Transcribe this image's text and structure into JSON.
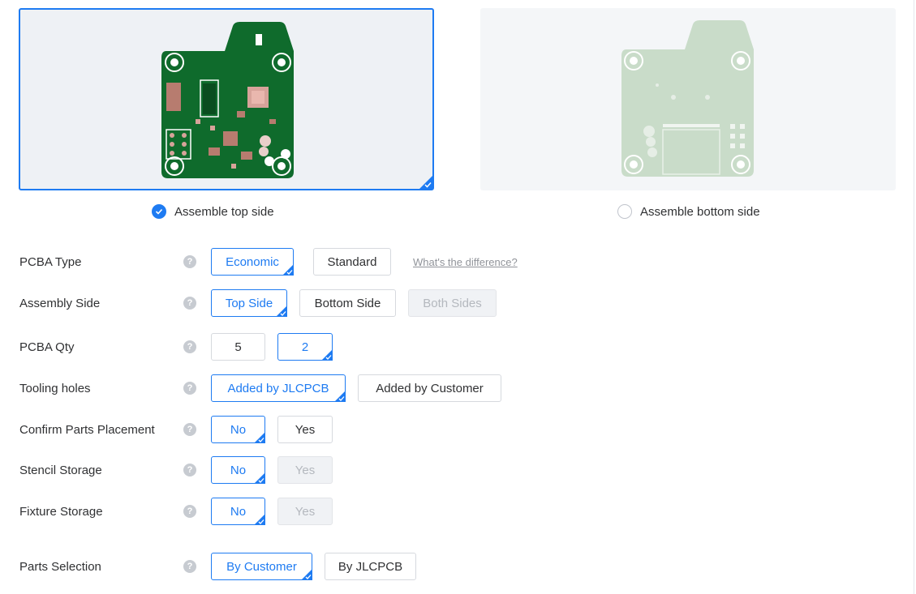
{
  "assembly_sides": {
    "top_label": "Assemble top side",
    "bottom_label": "Assemble bottom side",
    "selected": "top"
  },
  "form": {
    "pcba_type": {
      "label": "PCBA Type",
      "options": [
        "Economic",
        "Standard"
      ],
      "selected": "Economic",
      "link": "What's the difference?"
    },
    "assembly_side": {
      "label": "Assembly Side",
      "options": [
        "Top Side",
        "Bottom Side",
        "Both Sides"
      ],
      "selected": "Top Side",
      "disabled": [
        "Both Sides"
      ]
    },
    "pcba_qty": {
      "label": "PCBA Qty",
      "options": [
        "5",
        "2"
      ],
      "selected": "2"
    },
    "tooling_holes": {
      "label": "Tooling holes",
      "options": [
        "Added by JLCPCB",
        "Added by Customer"
      ],
      "selected": "Added by JLCPCB"
    },
    "confirm_parts_placement": {
      "label": "Confirm Parts Placement",
      "options": [
        "No",
        "Yes"
      ],
      "selected": "No"
    },
    "stencil_storage": {
      "label": "Stencil Storage",
      "options": [
        "No",
        "Yes"
      ],
      "selected": "No",
      "disabled": [
        "Yes"
      ]
    },
    "fixture_storage": {
      "label": "Fixture Storage",
      "options": [
        "No",
        "Yes"
      ],
      "selected": "No",
      "disabled": [
        "Yes"
      ]
    },
    "parts_selection": {
      "label": "Parts Selection",
      "options": [
        "By Customer",
        "By JLCPCB"
      ],
      "selected": "By Customer"
    }
  },
  "help_glyph": "?",
  "colors": {
    "accent": "#1e7bf2",
    "pcb_green": "#0f6b2c",
    "pcb_faded": "#c9dcc9"
  }
}
